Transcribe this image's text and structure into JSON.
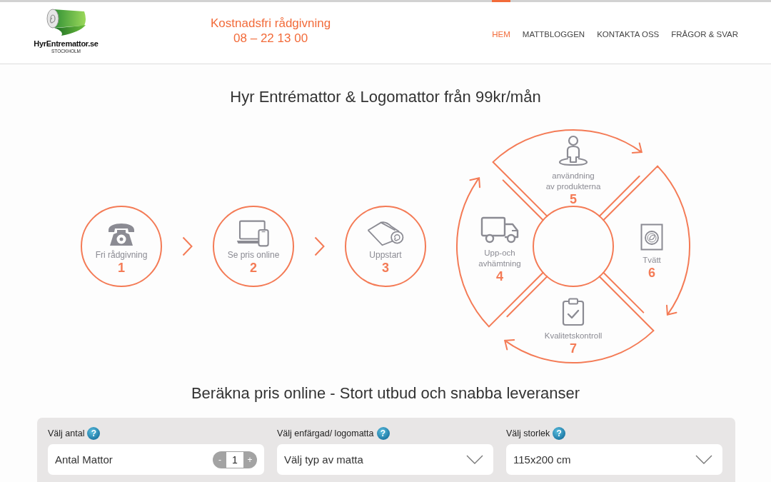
{
  "header": {
    "logo": {
      "name": "HyrEntremattor.se",
      "city": "STOCKHOLM"
    },
    "contact": {
      "label": "Kostnadsfri rådgivning",
      "phone": "08 – 22 13 00"
    },
    "nav": [
      {
        "label": "HEM",
        "selected": true
      },
      {
        "label": "MATTBLOGGEN",
        "selected": false
      },
      {
        "label": "KONTAKTA OSS",
        "selected": false
      },
      {
        "label": "FRÅGOR & SVAR",
        "selected": false
      }
    ]
  },
  "headline": "Hyr Entrémattor & Logomattor från 99kr/mån",
  "steps": [
    {
      "label": "Fri rådgivning",
      "number": "1"
    },
    {
      "label": "Se pris online",
      "number": "2"
    },
    {
      "label": "Uppstart",
      "number": "3"
    }
  ],
  "cycle": [
    {
      "label": "Upp-och\navhämtning",
      "number": "4"
    },
    {
      "label": "användning\nav produkterna",
      "number": "5"
    },
    {
      "label": "Tvätt",
      "number": "6"
    },
    {
      "label": "Kvalitetskontroll",
      "number": "7"
    }
  ],
  "calculator": {
    "title": "Beräkna pris online - Stort utbud och snabba leveranser",
    "fields": [
      {
        "kind": "stepper",
        "label": "Välj antal",
        "help": "?",
        "text": "Antal Mattor",
        "minus": "-",
        "count": "1",
        "plus": "+"
      },
      {
        "kind": "select",
        "label": "Välj enfärgad/ logomatta",
        "help": "?",
        "value": "Välj typ av matta"
      },
      {
        "kind": "select",
        "label": "Välj storlek",
        "help": "?",
        "value": "115x200 cm"
      }
    ]
  }
}
